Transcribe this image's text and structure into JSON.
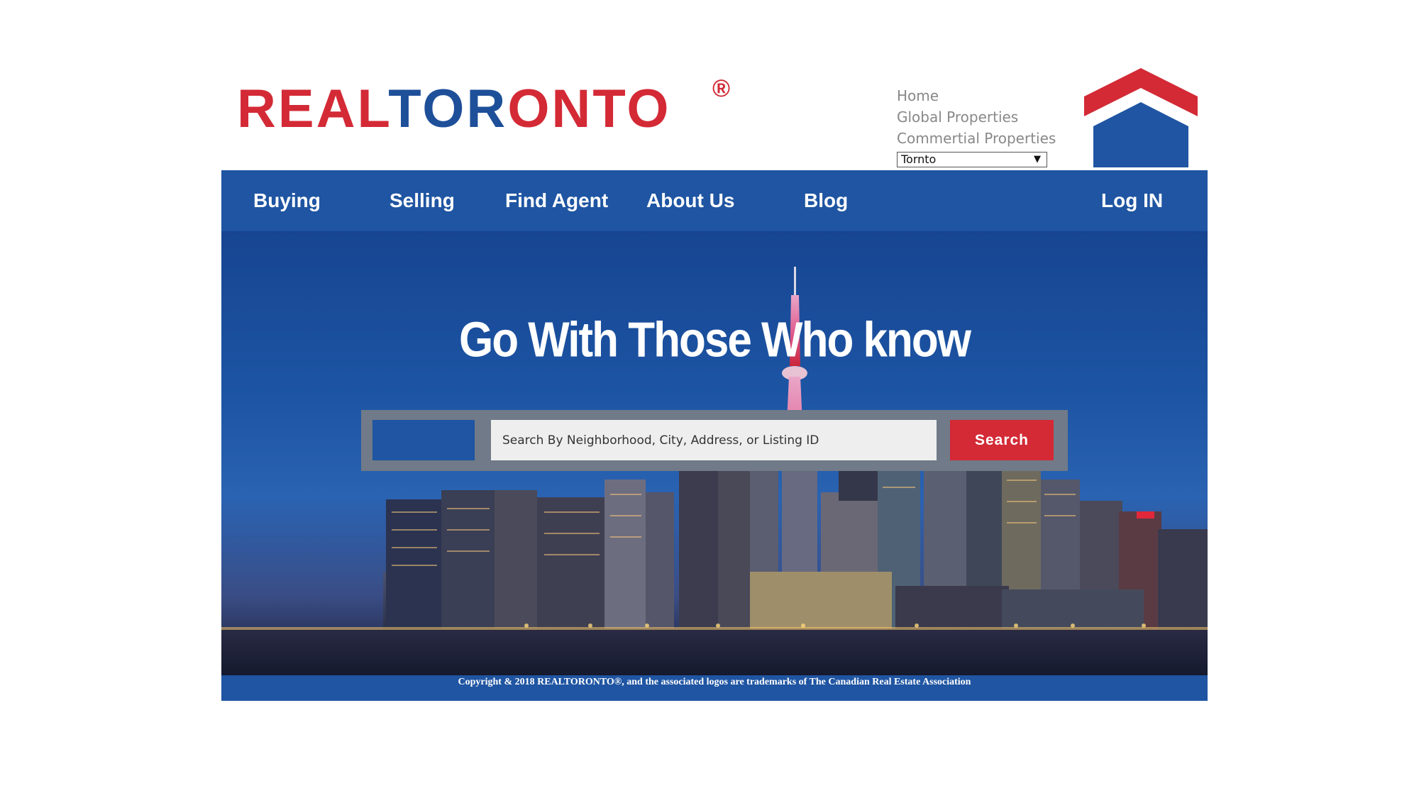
{
  "brand": {
    "logo_part1": "REAL",
    "logo_part2": "TOR",
    "logo_part3": "ONTO",
    "registered_mark": "®",
    "colors": {
      "red": "#d32a36",
      "blue": "#1e4f99",
      "nav_blue": "#1f55a2"
    }
  },
  "top_links": {
    "home": "Home",
    "global": "Global Properties",
    "commercial": "Commertial Properties"
  },
  "city_select": {
    "value": "Tornto",
    "arrow": "▼"
  },
  "nav": {
    "buying": "Buying",
    "selling": "Selling",
    "find_agent": "Find Agent",
    "about_us": "About Us",
    "blog": "Blog",
    "login": "Log IN"
  },
  "hero": {
    "title": "Go With Those Who know"
  },
  "search": {
    "placeholder": "Search By Neighborhood, City, Address, or Listing ID",
    "button_label": "Search"
  },
  "footer": {
    "copyright": "Copyright & 2018 REALTORONTO®, and the associated logos are trademarks of The Canadian Real Estate Association"
  },
  "icons": {
    "house": "house-logo-icon",
    "dropdown": "chevron-down-icon"
  }
}
